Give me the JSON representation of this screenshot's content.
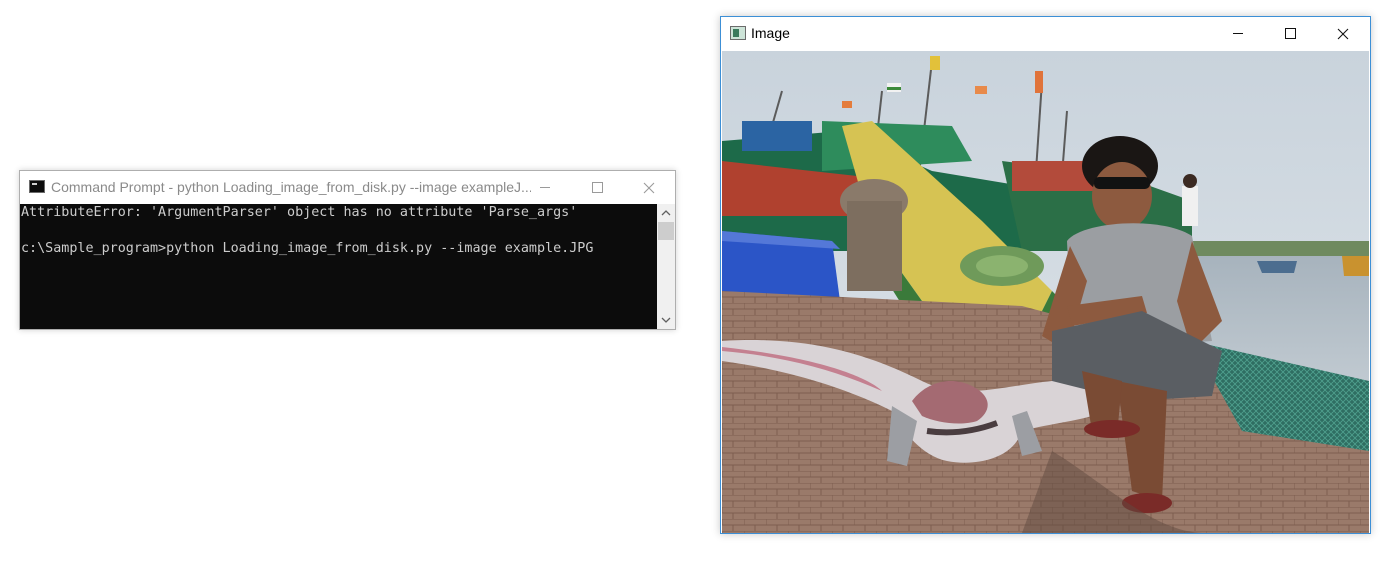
{
  "cmd_window": {
    "title": "Command Prompt - python  Loading_image_from_disk.py --image exampleJ...",
    "lines": [
      "AttributeError: 'ArgumentParser' object has no attribute 'Parse_args'",
      "",
      "c:\\Sample_program>python Loading_image_from_disk.py --image example.JPG"
    ],
    "icon": "console-icon",
    "text_color": "#cccccc",
    "background_color": "#0c0c0c"
  },
  "image_window": {
    "title": "Image",
    "icon": "image-icon",
    "border_color": "#3c8fd6"
  },
  "controls": {
    "minimize_icon": "minimize-icon",
    "maximize_icon": "maximize-icon",
    "close_icon": "close-icon"
  }
}
